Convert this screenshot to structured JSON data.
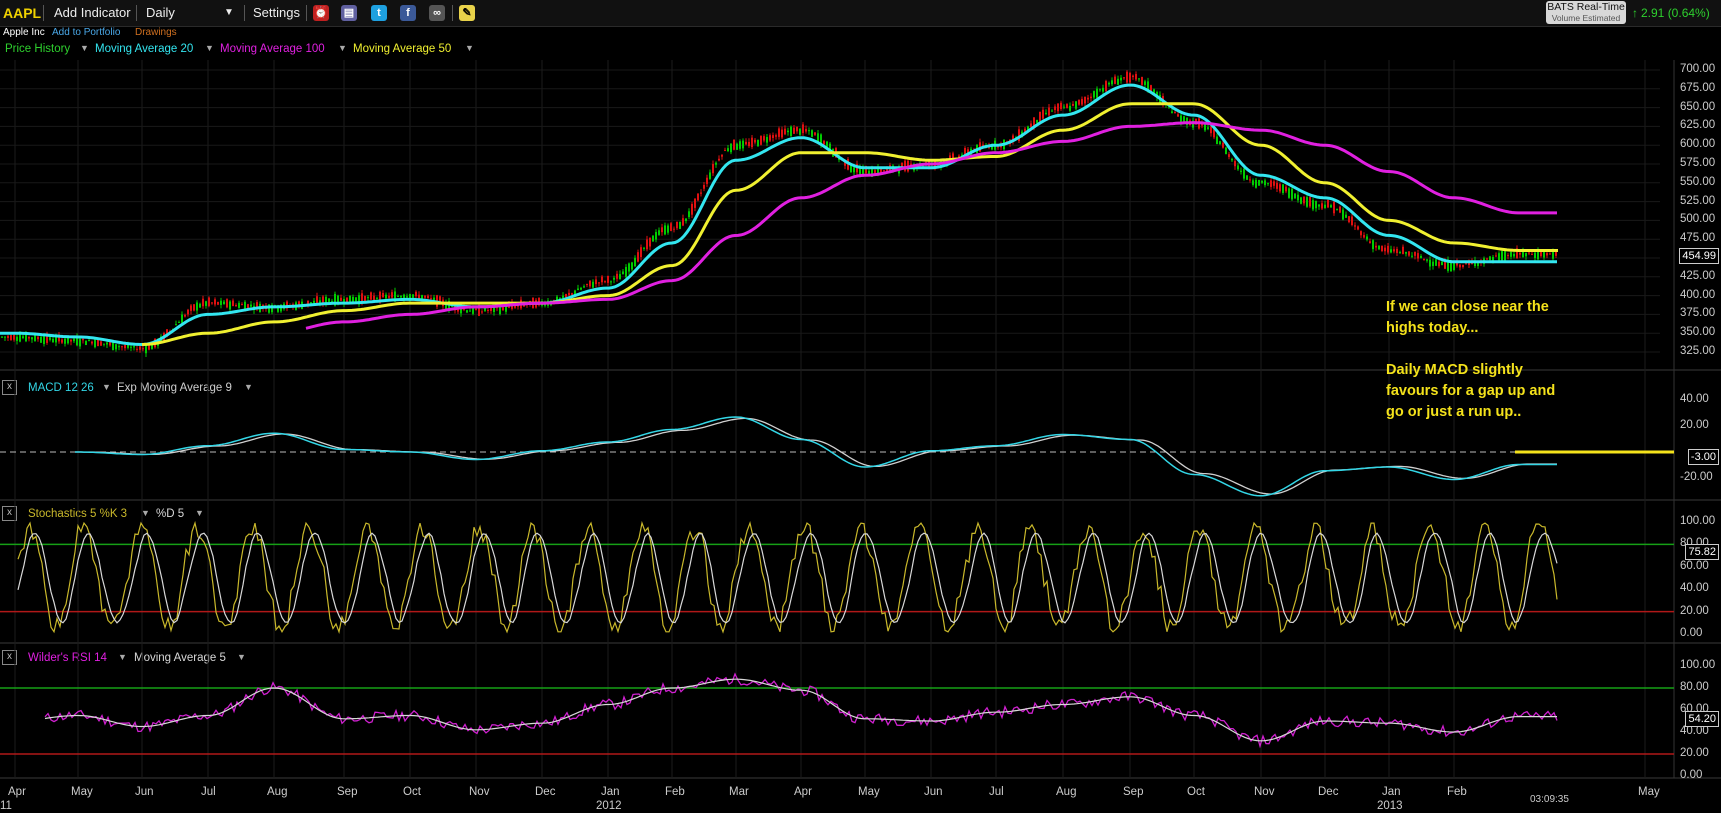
{
  "toolbar": {
    "symbol": "AAPL",
    "add_indicator": "Add Indicator",
    "interval": "Daily",
    "settings": "Settings",
    "feed_title": "BATS Real-Time",
    "feed_sub": "Volume Estimated",
    "change": "2.91 (0.64%)"
  },
  "subbar": {
    "company": "Apple Inc",
    "add_portfolio": "Add to Portfolio",
    "drawings": "Drawings"
  },
  "colors": {
    "up": "#00cc00",
    "down": "#e01010",
    "ma20": "#33e6f0",
    "ma100": "#e020e0",
    "ma50": "#f0f030",
    "macd": "#33d6e6",
    "signal": "#cfcfcf",
    "stoch_k": "#c9b82b",
    "stoch_d": "#d8d8d8",
    "rsi": "#d020d0",
    "rsi_ma": "#d8d8d8",
    "upper_band": "#16a016",
    "lower_band": "#b01818",
    "note": "#f4e21b"
  },
  "price_panel": {
    "indicators": [
      "Price History",
      "Moving Average 20",
      "Moving Average 100",
      "Moving Average 50"
    ],
    "y_ticks": [
      "700.00",
      "675.00",
      "650.00",
      "625.00",
      "600.00",
      "575.00",
      "550.00",
      "525.00",
      "500.00",
      "475.00",
      "450.00",
      "425.00",
      "400.00",
      "375.00",
      "350.00",
      "325.00"
    ],
    "last_price": "454.99"
  },
  "macd_panel": {
    "indicators": [
      "MACD 12 26",
      "Exp Moving Average 9"
    ],
    "y_ticks": [
      "40.00",
      "20.00",
      "-20.00"
    ],
    "last_value": "-3.00"
  },
  "stoch_panel": {
    "indicators": [
      "Stochastics 5 %K 3",
      "%D 5"
    ],
    "y_ticks": [
      "100.00",
      "80.00",
      "60.00",
      "40.00",
      "20.00",
      "0.00"
    ],
    "last_value": "75.82"
  },
  "rsi_panel": {
    "indicators": [
      "Wilder's RSI 14",
      "Moving Average 5"
    ],
    "y_ticks": [
      "100.00",
      "80.00",
      "60.00",
      "40.00",
      "20.00",
      "0.00"
    ],
    "last_value": "54.20"
  },
  "annotations": {
    "note1": [
      "If we can close near the",
      "highs today..."
    ],
    "note2": [
      "Daily MACD slightly",
      "favours for a gap up and",
      "go or just a run up.."
    ]
  },
  "x_axis": {
    "months": [
      "Apr",
      "May",
      "Jun",
      "Jul",
      "Aug",
      "Sep",
      "Oct",
      "Nov",
      "Dec",
      "Jan",
      "Feb",
      "Mar",
      "Apr",
      "May",
      "Jun",
      "Jul",
      "Aug",
      "Sep",
      "Oct",
      "Nov",
      "Dec",
      "Jan",
      "Feb",
      "May"
    ],
    "years": [
      "11",
      "2012",
      "2013"
    ],
    "time": "03:09:35"
  },
  "chart_data": {
    "type": "line",
    "title": "AAPL",
    "x": [
      "2011-04",
      "2011-05",
      "2011-06",
      "2011-07",
      "2011-08",
      "2011-09",
      "2011-10",
      "2011-11",
      "2011-12",
      "2012-01",
      "2012-02",
      "2012-03",
      "2012-04",
      "2012-05",
      "2012-06",
      "2012-07",
      "2012-08",
      "2012-09",
      "2012-10",
      "2012-11",
      "2012-12",
      "2013-01",
      "2013-02",
      "2013-03"
    ],
    "series": [
      {
        "name": "Price History",
        "values": [
          345,
          340,
          330,
          390,
          385,
          395,
          400,
          380,
          390,
          420,
          490,
          600,
          620,
          565,
          575,
          600,
          650,
          690,
          630,
          550,
          520,
          460,
          440,
          455
        ]
      },
      {
        "name": "Moving Average 20",
        "values": [
          350,
          345,
          335,
          375,
          385,
          390,
          395,
          385,
          390,
          410,
          470,
          580,
          610,
          570,
          570,
          600,
          640,
          680,
          640,
          560,
          530,
          480,
          445,
          445
        ]
      },
      {
        "name": "Moving Average 50",
        "values": [
          null,
          340,
          335,
          350,
          365,
          380,
          390,
          390,
          390,
          400,
          440,
          540,
          590,
          590,
          580,
          585,
          620,
          655,
          655,
          600,
          550,
          500,
          470,
          460
        ]
      },
      {
        "name": "Moving Average 100",
        "values": [
          null,
          null,
          null,
          null,
          350,
          365,
          375,
          385,
          390,
          395,
          420,
          480,
          530,
          560,
          575,
          590,
          605,
          625,
          630,
          620,
          600,
          565,
          530,
          510
        ]
      }
    ],
    "ylim": [
      310,
      710
    ]
  }
}
